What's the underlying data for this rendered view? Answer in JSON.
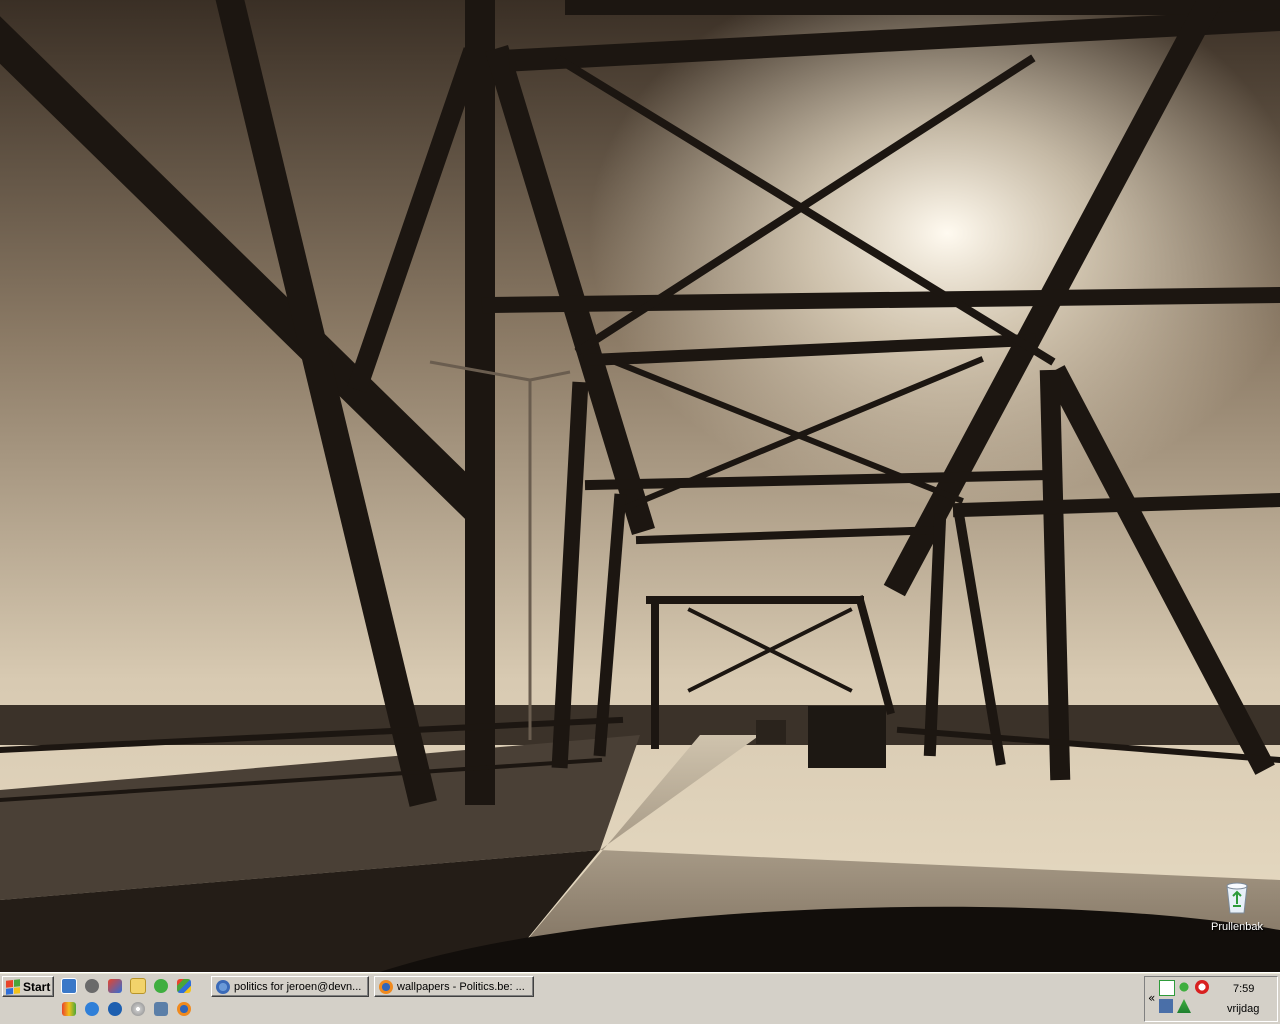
{
  "desktop": {
    "icons": [
      {
        "label": "Prullenbak",
        "icon": "recycle-bin-icon"
      }
    ]
  },
  "taskbar": {
    "start_label": "Start",
    "quick_launch": [
      {
        "name": "internet-explorer-settings-icon"
      },
      {
        "name": "msn-messenger-icon"
      },
      {
        "name": "windows-media-icon"
      },
      {
        "name": "folder-icon"
      },
      {
        "name": "winamp-icon"
      },
      {
        "name": "windows-update-icon"
      },
      {
        "name": "paint-icon"
      },
      {
        "name": "internet-explorer-icon"
      },
      {
        "name": "media-player-icon"
      },
      {
        "name": "cd-icon"
      },
      {
        "name": "network-icon"
      },
      {
        "name": "firefox-icon"
      }
    ],
    "tasks": [
      {
        "label": "politics for jeroen@devn...",
        "icon": "browser-icon"
      },
      {
        "label": "wallpapers - Politics.be: ...",
        "icon": "firefox-icon"
      }
    ],
    "tray": {
      "time": "7:59",
      "day": "vrijdag",
      "chevron": "«"
    }
  },
  "colors": {
    "taskbar": "#d4d0c8",
    "sepia_light": "#e9ddc6",
    "sepia_dark": "#2a221a"
  }
}
